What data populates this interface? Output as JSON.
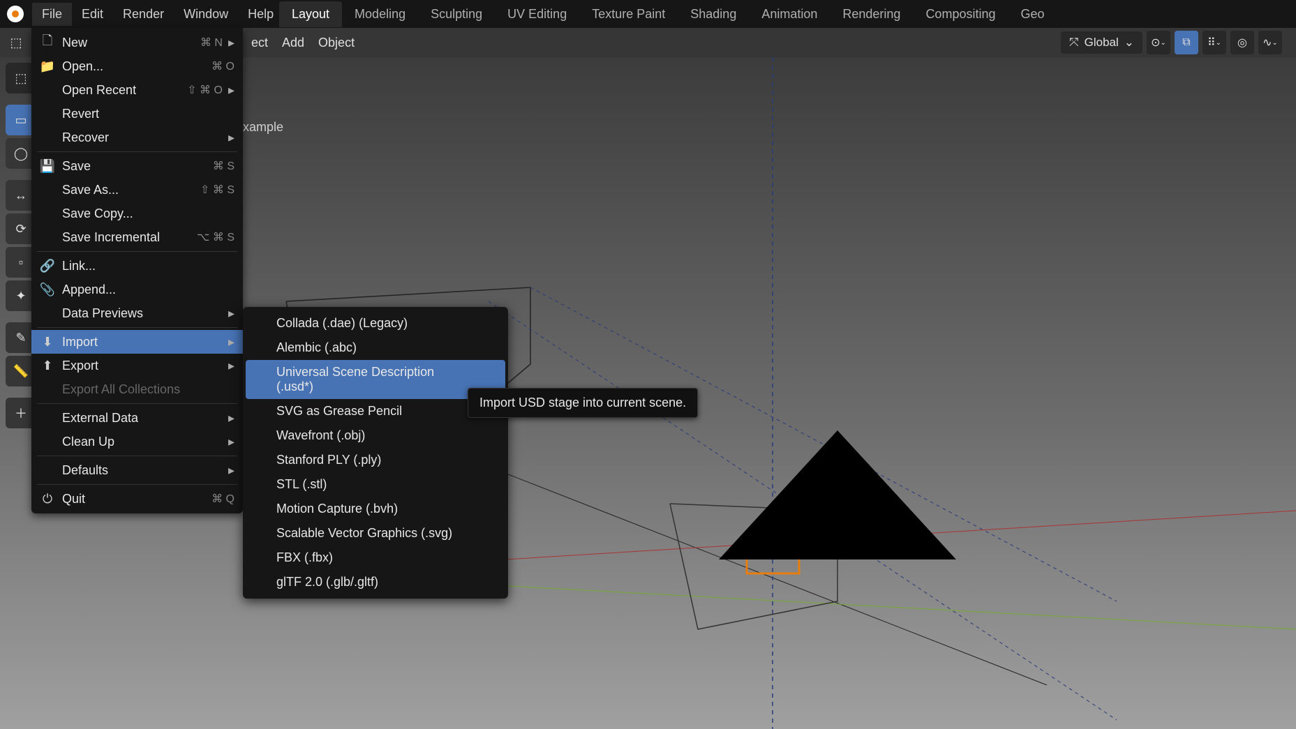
{
  "top_menu": {
    "file": "File",
    "edit": "Edit",
    "render": "Render",
    "window": "Window",
    "help": "Help"
  },
  "workspaces": {
    "layout": "Layout",
    "modeling": "Modeling",
    "sculpting": "Sculpting",
    "uv_editing": "UV Editing",
    "texture_paint": "Texture Paint",
    "shading": "Shading",
    "animation": "Animation",
    "rendering": "Rendering",
    "compositing": "Compositing",
    "geo": "Geo"
  },
  "header": {
    "object_partial": "ect",
    "add": "Add",
    "object": "Object",
    "orientation": "Global"
  },
  "viewport": {
    "label_partial": "xample"
  },
  "file_menu": {
    "new": "New",
    "new_sc": "⌘ N",
    "open": "Open...",
    "open_sc": "⌘ O",
    "open_recent": "Open Recent",
    "open_recent_sc": "⇧ ⌘ O",
    "revert": "Revert",
    "recover": "Recover",
    "save": "Save",
    "save_sc": "⌘ S",
    "save_as": "Save As...",
    "save_as_sc": "⇧ ⌘ S",
    "save_copy": "Save Copy...",
    "save_incremental": "Save Incremental",
    "save_inc_sc": "⌥ ⌘ S",
    "link": "Link...",
    "append": "Append...",
    "data_previews": "Data Previews",
    "import": "Import",
    "export": "Export",
    "export_all": "Export All Collections",
    "external_data": "External Data",
    "clean_up": "Clean Up",
    "defaults": "Defaults",
    "quit": "Quit",
    "quit_sc": "⌘ Q"
  },
  "import_submenu": {
    "collada": "Collada (.dae) (Legacy)",
    "alembic": "Alembic (.abc)",
    "usd": "Universal Scene Description (.usd*)",
    "svg_gp": "SVG as Grease Pencil",
    "wavefront": "Wavefront (.obj)",
    "stanford": "Stanford PLY (.ply)",
    "stl": "STL (.stl)",
    "bvh": "Motion Capture (.bvh)",
    "svg": "Scalable Vector Graphics (.svg)",
    "fbx": "FBX (.fbx)",
    "gltf": "glTF 2.0 (.glb/.gltf)"
  },
  "tooltip": {
    "usd_import": "Import USD stage into current scene."
  }
}
